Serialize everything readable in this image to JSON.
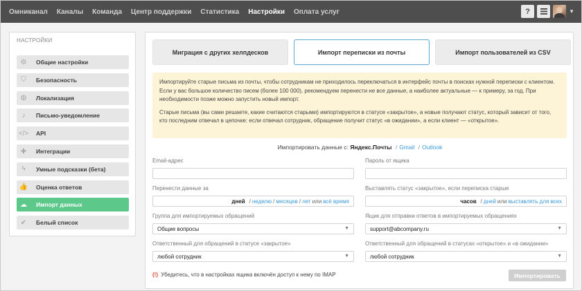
{
  "nav": {
    "items": [
      "Омниканал",
      "Каналы",
      "Команда",
      "Центр поддержки",
      "Статистика",
      "Настройки",
      "Оплата услуг"
    ],
    "active_index": 5,
    "help_label": "?"
  },
  "sidebar": {
    "title": "НАСТРОЙКИ",
    "items": [
      {
        "label": "Общие настройки",
        "icon": "gears-icon",
        "glyph": "⚙"
      },
      {
        "label": "Безопасность",
        "icon": "shield-icon",
        "glyph": "⛉"
      },
      {
        "label": "Локализация",
        "icon": "globe-icon",
        "glyph": "◍"
      },
      {
        "label": "Письмо-уведомление",
        "icon": "bell-icon",
        "glyph": "♪"
      },
      {
        "label": "API",
        "icon": "code-icon",
        "glyph": "</>"
      },
      {
        "label": "Интеграции",
        "icon": "puzzle-icon",
        "glyph": "✚"
      },
      {
        "label": "Умные подсказки (бета)",
        "icon": "bolt-icon",
        "glyph": "ϟ"
      },
      {
        "label": "Оценка ответов",
        "icon": "thumbs-up-icon",
        "glyph": "👍"
      },
      {
        "label": "Импорт данных",
        "icon": "cloud-upload-icon",
        "glyph": "☁"
      },
      {
        "label": "Белый список",
        "icon": "check-circle-icon",
        "glyph": "✔"
      }
    ],
    "active_index": 8
  },
  "tabs": [
    {
      "label": "Миграция с других хелпдесков"
    },
    {
      "label": "Импорт переписки из почты"
    },
    {
      "label": "Импорт пользователей из CSV"
    }
  ],
  "active_tab": 1,
  "notice": {
    "p1": "Импортируйте старые письма из почты, чтобы сотрудникам не приходилось переключаться в интерфейс почты в поисках нужной переписки с клиентом. Если у вас большое количество писем (более 100 000), рекомендуем перенести не все данные, а наиболее актуальные — к примеру, за год. При необходимости позже можно запустить новый импорт.",
    "p2": "Старые письма (вы сами решаете, какие считаются старыми) импортируются в статусе «закрытое», а новые получают статус, который зависит от того, кто последним отвечал в цепочке: если отвечал сотрудник, обращение получит статус «в ожидании», а если клиент — «открытое»."
  },
  "import_from": {
    "label": "Импортировать данные с:",
    "current": "Яндекс.Почты",
    "sep": "/",
    "options": [
      "Gmail",
      "Outlook"
    ]
  },
  "form": {
    "email": {
      "label": "Email-адрес",
      "value": ""
    },
    "password": {
      "label": "Пароль от ящика",
      "value": ""
    },
    "transfer": {
      "label": "Перенести данные за",
      "value": "дней",
      "links": [
        "неделю",
        "месяцев",
        "лет"
      ],
      "or": "или",
      "all_link": "всё время",
      "sep": "/"
    },
    "close_status": {
      "label": "Выставлять статус «закрытое», если переписка старше",
      "value": "часов",
      "links": [
        "дней"
      ],
      "or": "или",
      "all_link": "выставлять для всех",
      "sep": "/"
    },
    "group": {
      "label": "Группа для импортируемых обращений",
      "value": "Общие вопросы"
    },
    "reply_mailbox": {
      "label": "Ящик для отправки ответов в импортируемых обращениях",
      "value": "support@abcompany.ru"
    },
    "responsible_closed": {
      "label": "Ответственный для обращений в статусе «закрытое»",
      "value": "любой сотрудник"
    },
    "responsible_open": {
      "label": "Ответственный для обращений в статусах «открытое» и «в ожидании»",
      "value": "любой сотрудник"
    }
  },
  "imap_note": {
    "mark": "(!)",
    "text": "Убедитесь, что в настройках ящика включён доступ к нему по IMAP"
  },
  "import_button": {
    "label": "Импортировать"
  },
  "colors": {
    "active_green": "#5cc88a",
    "link_blue": "#3b9ad9",
    "notice_bg": "#fdf3d6",
    "nav_bg": "#4e4e4e",
    "warn_red": "#d9432f"
  }
}
